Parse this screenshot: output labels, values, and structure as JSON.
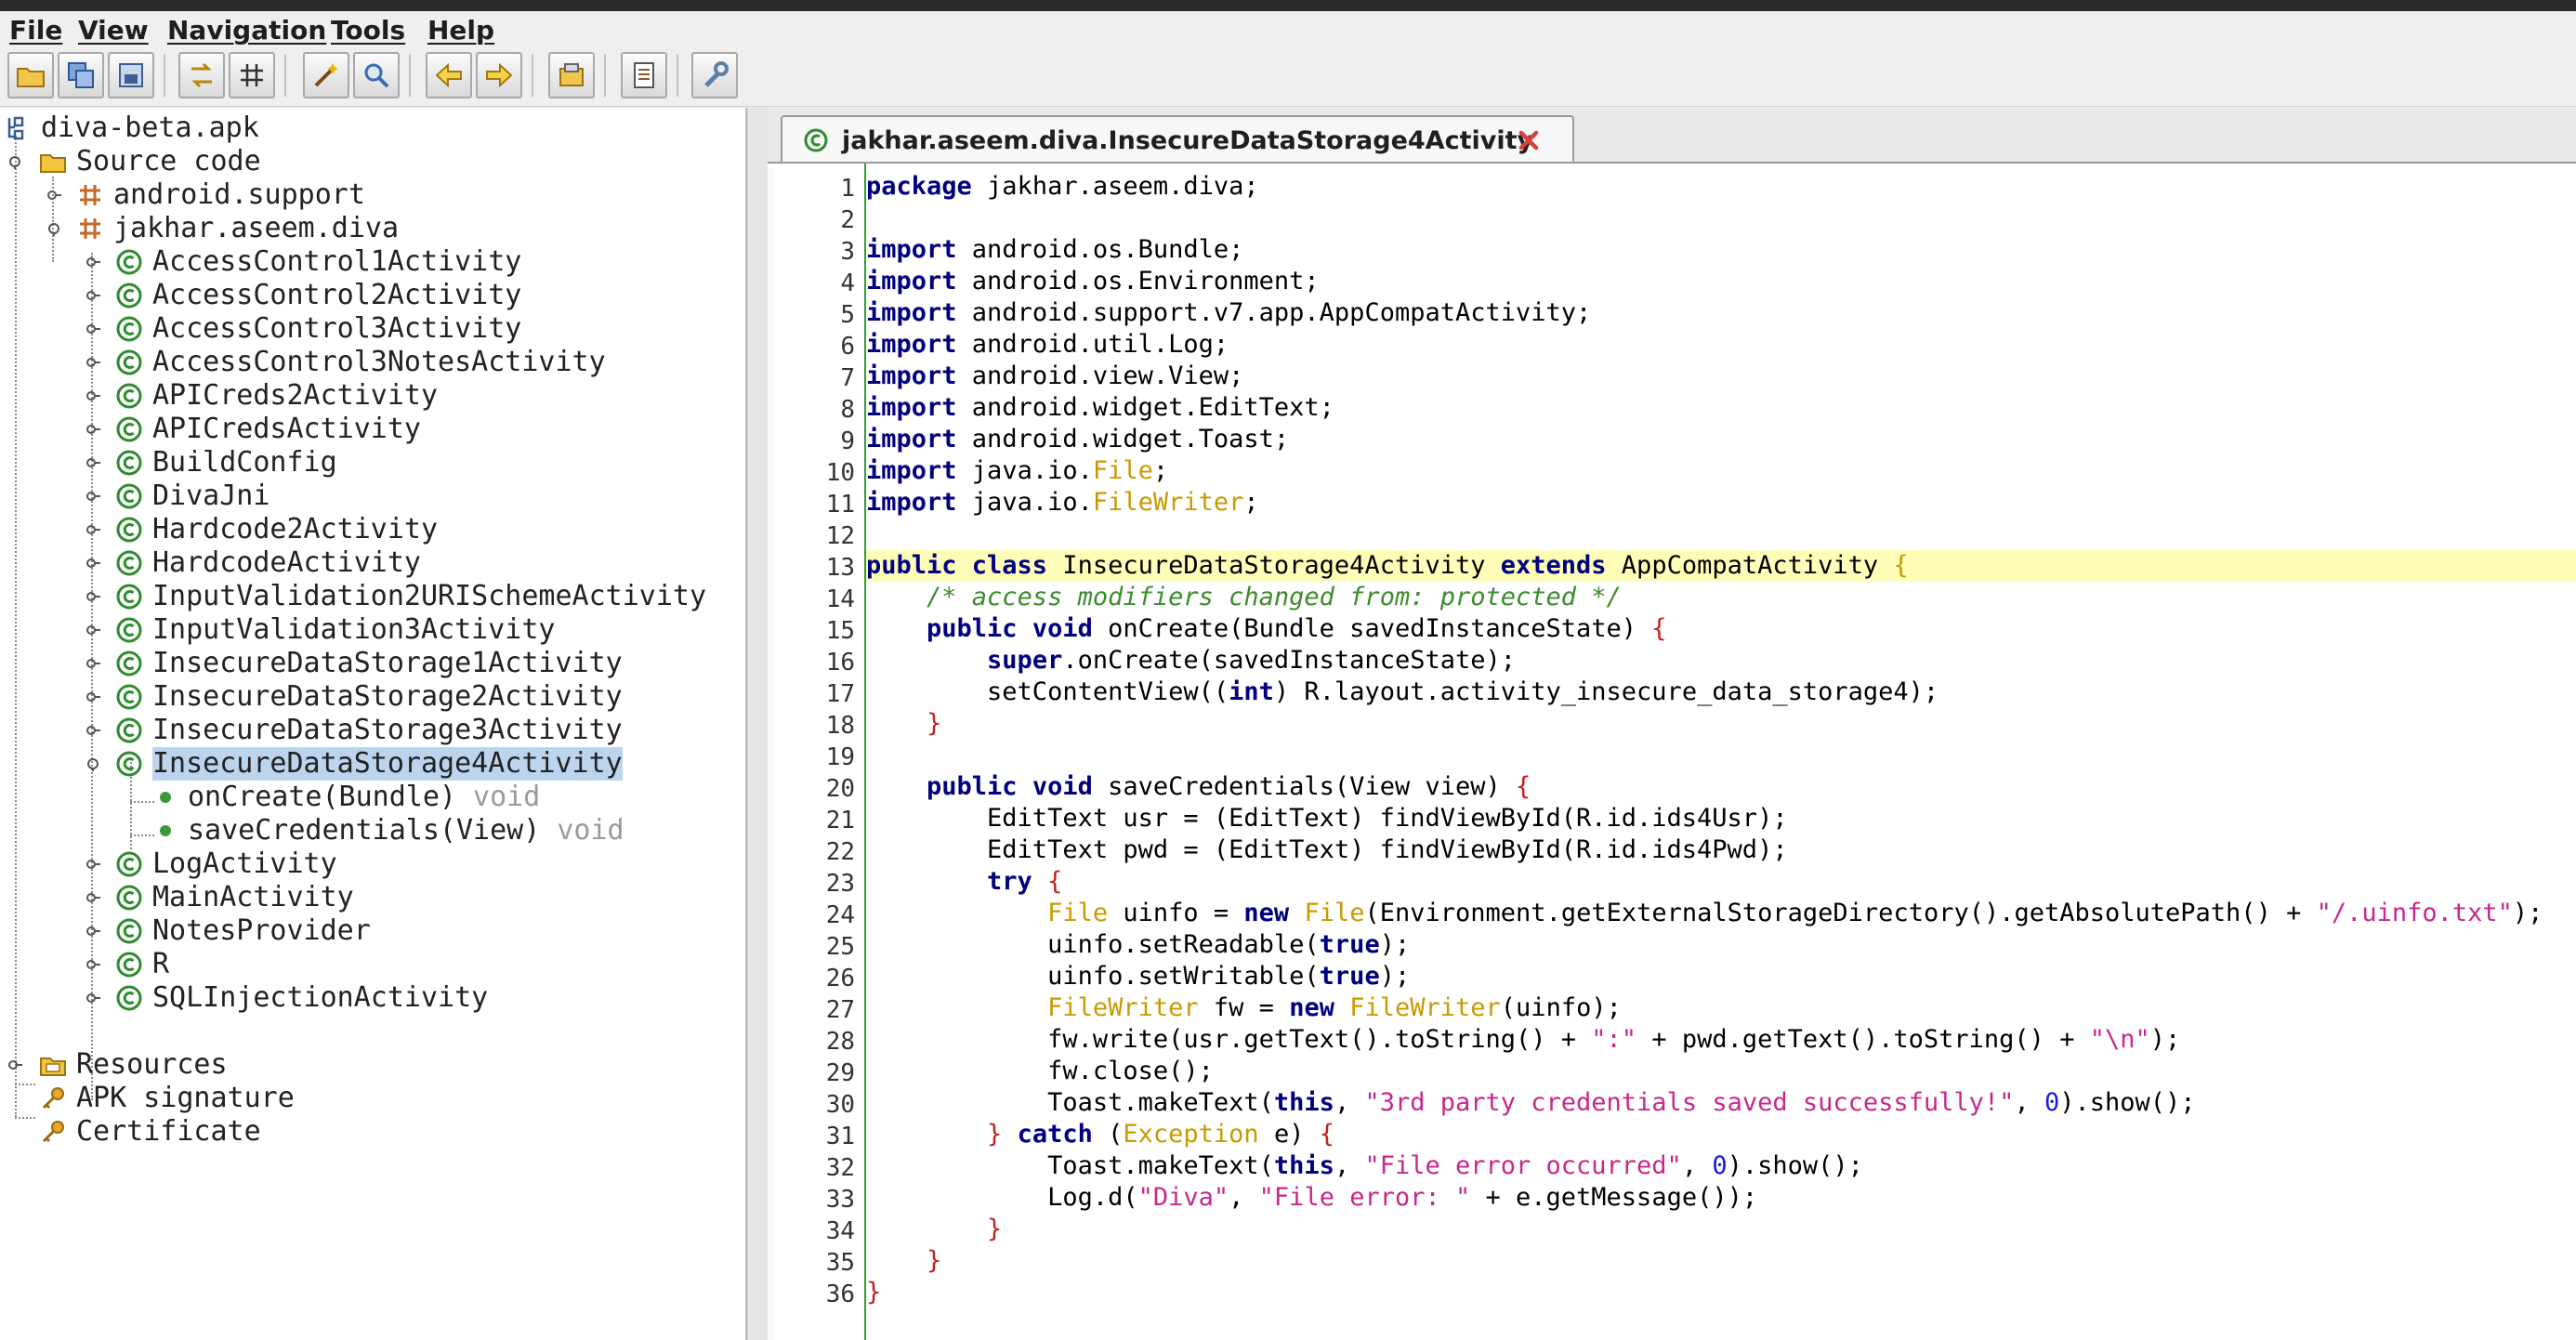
{
  "menubar": {
    "items": [
      "File",
      "View",
      "Navigation",
      "Tools",
      "Help"
    ]
  },
  "toolbar": {
    "buttons": [
      "open-file-icon",
      "save-all-icon",
      "export-icon",
      "sync-icon",
      "flatten-packages-icon",
      "magic-wand-icon",
      "search-icon",
      "back-arrow-icon",
      "forward-arrow-icon",
      "deobfuscation-icon",
      "log-viewer-icon",
      "preferences-icon"
    ]
  },
  "tree": {
    "root": "diva-beta.apk",
    "source_code": "Source code",
    "pkg_support": "android.support",
    "pkg_diva": "jakhar.aseem.diva",
    "classes": [
      "AccessControl1Activity",
      "AccessControl2Activity",
      "AccessControl3Activity",
      "AccessControl3NotesActivity",
      "APICreds2Activity",
      "APICredsActivity",
      "BuildConfig",
      "DivaJni",
      "Hardcode2Activity",
      "HardcodeActivity",
      "InputValidation2URISchemeActivity",
      "InputValidation3Activity",
      "InsecureDataStorage1Activity",
      "InsecureDataStorage2Activity",
      "InsecureDataStorage3Activity",
      "InsecureDataStorage4Activity"
    ],
    "methods": [
      {
        "name": "onCreate(Bundle)",
        "ret": "void"
      },
      {
        "name": "saveCredentials(View)",
        "ret": "void"
      }
    ],
    "classes_after": [
      "LogActivity",
      "MainActivity",
      "NotesProvider",
      "R",
      "SQLInjectionActivity"
    ],
    "resources": "Resources",
    "apk_signature": "APK signature",
    "certificate": "Certificate"
  },
  "editor": {
    "tab_title": "jakhar.aseem.diva.InsecureDataStorage4Activity",
    "highlighted_line": 13,
    "line_numbers": [
      "1",
      "2",
      "3",
      "4",
      "5",
      "6",
      "7",
      "8",
      "9",
      "10",
      "11",
      "12",
      "13",
      "14",
      "15",
      "16",
      "17",
      "18",
      "19",
      "20",
      "21",
      "22",
      "23",
      "24",
      "25",
      "26",
      "27",
      "28",
      "29",
      "30",
      "31",
      "32",
      "33",
      "34",
      "35",
      "36"
    ],
    "lines": [
      [
        [
          "k",
          "package"
        ],
        [
          "t",
          " jakhar.aseem.diva;"
        ]
      ],
      [],
      [
        [
          "k",
          "import"
        ],
        [
          "t",
          " android.os.Bundle;"
        ]
      ],
      [
        [
          "k",
          "import"
        ],
        [
          "t",
          " android.os.Environment;"
        ]
      ],
      [
        [
          "k",
          "import"
        ],
        [
          "t",
          " android.support.v7.app.AppCompatActivity;"
        ]
      ],
      [
        [
          "k",
          "import"
        ],
        [
          "t",
          " android.util.Log;"
        ]
      ],
      [
        [
          "k",
          "import"
        ],
        [
          "t",
          " android.view.View;"
        ]
      ],
      [
        [
          "k",
          "import"
        ],
        [
          "t",
          " android.widget.EditText;"
        ]
      ],
      [
        [
          "k",
          "import"
        ],
        [
          "t",
          " android.widget.Toast;"
        ]
      ],
      [
        [
          "k",
          "import"
        ],
        [
          "t",
          " java.io."
        ],
        [
          "y",
          "File"
        ],
        [
          "t",
          ";"
        ]
      ],
      [
        [
          "k",
          "import"
        ],
        [
          "t",
          " java.io."
        ],
        [
          "y",
          "FileWriter"
        ],
        [
          "t",
          ";"
        ]
      ],
      [],
      [
        [
          "k",
          "public class"
        ],
        [
          "t",
          " InsecureDataStorage4Activity "
        ],
        [
          "k",
          "extends"
        ],
        [
          "t",
          " AppCompatActivity "
        ],
        [
          "y",
          "{"
        ]
      ],
      [
        [
          "t",
          "    "
        ],
        [
          "c",
          "/* access modifiers changed from: protected */"
        ]
      ],
      [
        [
          "t",
          "    "
        ],
        [
          "k",
          "public void"
        ],
        [
          "t",
          " onCreate(Bundle savedInstanceState) "
        ],
        [
          "p",
          "{"
        ]
      ],
      [
        [
          "t",
          "        "
        ],
        [
          "k",
          "super"
        ],
        [
          "t",
          ".onCreate(savedInstanceState);"
        ]
      ],
      [
        [
          "t",
          "        setContentView(("
        ],
        [
          "k",
          "int"
        ],
        [
          "t",
          ") R.layout.activity_insecure_data_storage4);"
        ]
      ],
      [
        [
          "t",
          "    "
        ],
        [
          "p",
          "}"
        ]
      ],
      [],
      [
        [
          "t",
          "    "
        ],
        [
          "k",
          "public void"
        ],
        [
          "t",
          " saveCredentials(View view) "
        ],
        [
          "p",
          "{"
        ]
      ],
      [
        [
          "t",
          "        EditText usr = (EditText) findViewById(R.id.ids4Usr);"
        ]
      ],
      [
        [
          "t",
          "        EditText pwd = (EditText) findViewById(R.id.ids4Pwd);"
        ]
      ],
      [
        [
          "t",
          "        "
        ],
        [
          "k",
          "try"
        ],
        [
          "t",
          " "
        ],
        [
          "p",
          "{"
        ]
      ],
      [
        [
          "t",
          "            "
        ],
        [
          "y",
          "File"
        ],
        [
          "t",
          " uinfo = "
        ],
        [
          "k",
          "new"
        ],
        [
          "t",
          " "
        ],
        [
          "y",
          "File"
        ],
        [
          "t",
          "(Environment.getExternalStorageDirectory().getAbsolutePath() + "
        ],
        [
          "s",
          "\"/.uinfo.txt\""
        ],
        [
          "t",
          ");"
        ]
      ],
      [
        [
          "t",
          "            uinfo.setReadable("
        ],
        [
          "k",
          "true"
        ],
        [
          "t",
          ");"
        ]
      ],
      [
        [
          "t",
          "            uinfo.setWritable("
        ],
        [
          "k",
          "true"
        ],
        [
          "t",
          ");"
        ]
      ],
      [
        [
          "t",
          "            "
        ],
        [
          "y",
          "FileWriter"
        ],
        [
          "t",
          " fw = "
        ],
        [
          "k",
          "new"
        ],
        [
          "t",
          " "
        ],
        [
          "y",
          "FileWriter"
        ],
        [
          "t",
          "(uinfo);"
        ]
      ],
      [
        [
          "t",
          "            fw.write(usr.getText().toString() + "
        ],
        [
          "s",
          "\":\""
        ],
        [
          "t",
          " + pwd.getText().toString() + "
        ],
        [
          "s",
          "\"\\n\""
        ],
        [
          "t",
          ");"
        ]
      ],
      [
        [
          "t",
          "            fw.close();"
        ]
      ],
      [
        [
          "t",
          "            Toast.makeText("
        ],
        [
          "k",
          "this"
        ],
        [
          "t",
          ", "
        ],
        [
          "s",
          "\"3rd party credentials saved successfully!\""
        ],
        [
          "t",
          ", "
        ],
        [
          "n",
          "0"
        ],
        [
          "t",
          ").show();"
        ]
      ],
      [
        [
          "t",
          "        "
        ],
        [
          "p",
          "}"
        ],
        [
          "t",
          " "
        ],
        [
          "k",
          "catch"
        ],
        [
          "t",
          " ("
        ],
        [
          "y",
          "Exception"
        ],
        [
          "t",
          " e) "
        ],
        [
          "p",
          "{"
        ]
      ],
      [
        [
          "t",
          "            Toast.makeText("
        ],
        [
          "k",
          "this"
        ],
        [
          "t",
          ", "
        ],
        [
          "s",
          "\"File error occurred\""
        ],
        [
          "t",
          ", "
        ],
        [
          "n",
          "0"
        ],
        [
          "t",
          ").show();"
        ]
      ],
      [
        [
          "t",
          "            Log.d("
        ],
        [
          "s",
          "\"Diva\""
        ],
        [
          "t",
          ", "
        ],
        [
          "s",
          "\"File error: \""
        ],
        [
          "t",
          " + e.getMessage());"
        ]
      ],
      [
        [
          "t",
          "        "
        ],
        [
          "p",
          "}"
        ]
      ],
      [
        [
          "t",
          "    "
        ],
        [
          "p",
          "}"
        ]
      ],
      [
        [
          "p",
          "}"
        ]
      ]
    ]
  },
  "colors": {
    "keyword": "#000080",
    "string": "#c8278c",
    "comment": "#3c8c2c",
    "type_ref": "#c99a00",
    "number": "#1b1bd0",
    "highlight_line": "#fdfdb8",
    "gutter_border": "#33a033",
    "class_icon": "#2e8b2e",
    "selection": "#bdd4ee"
  }
}
